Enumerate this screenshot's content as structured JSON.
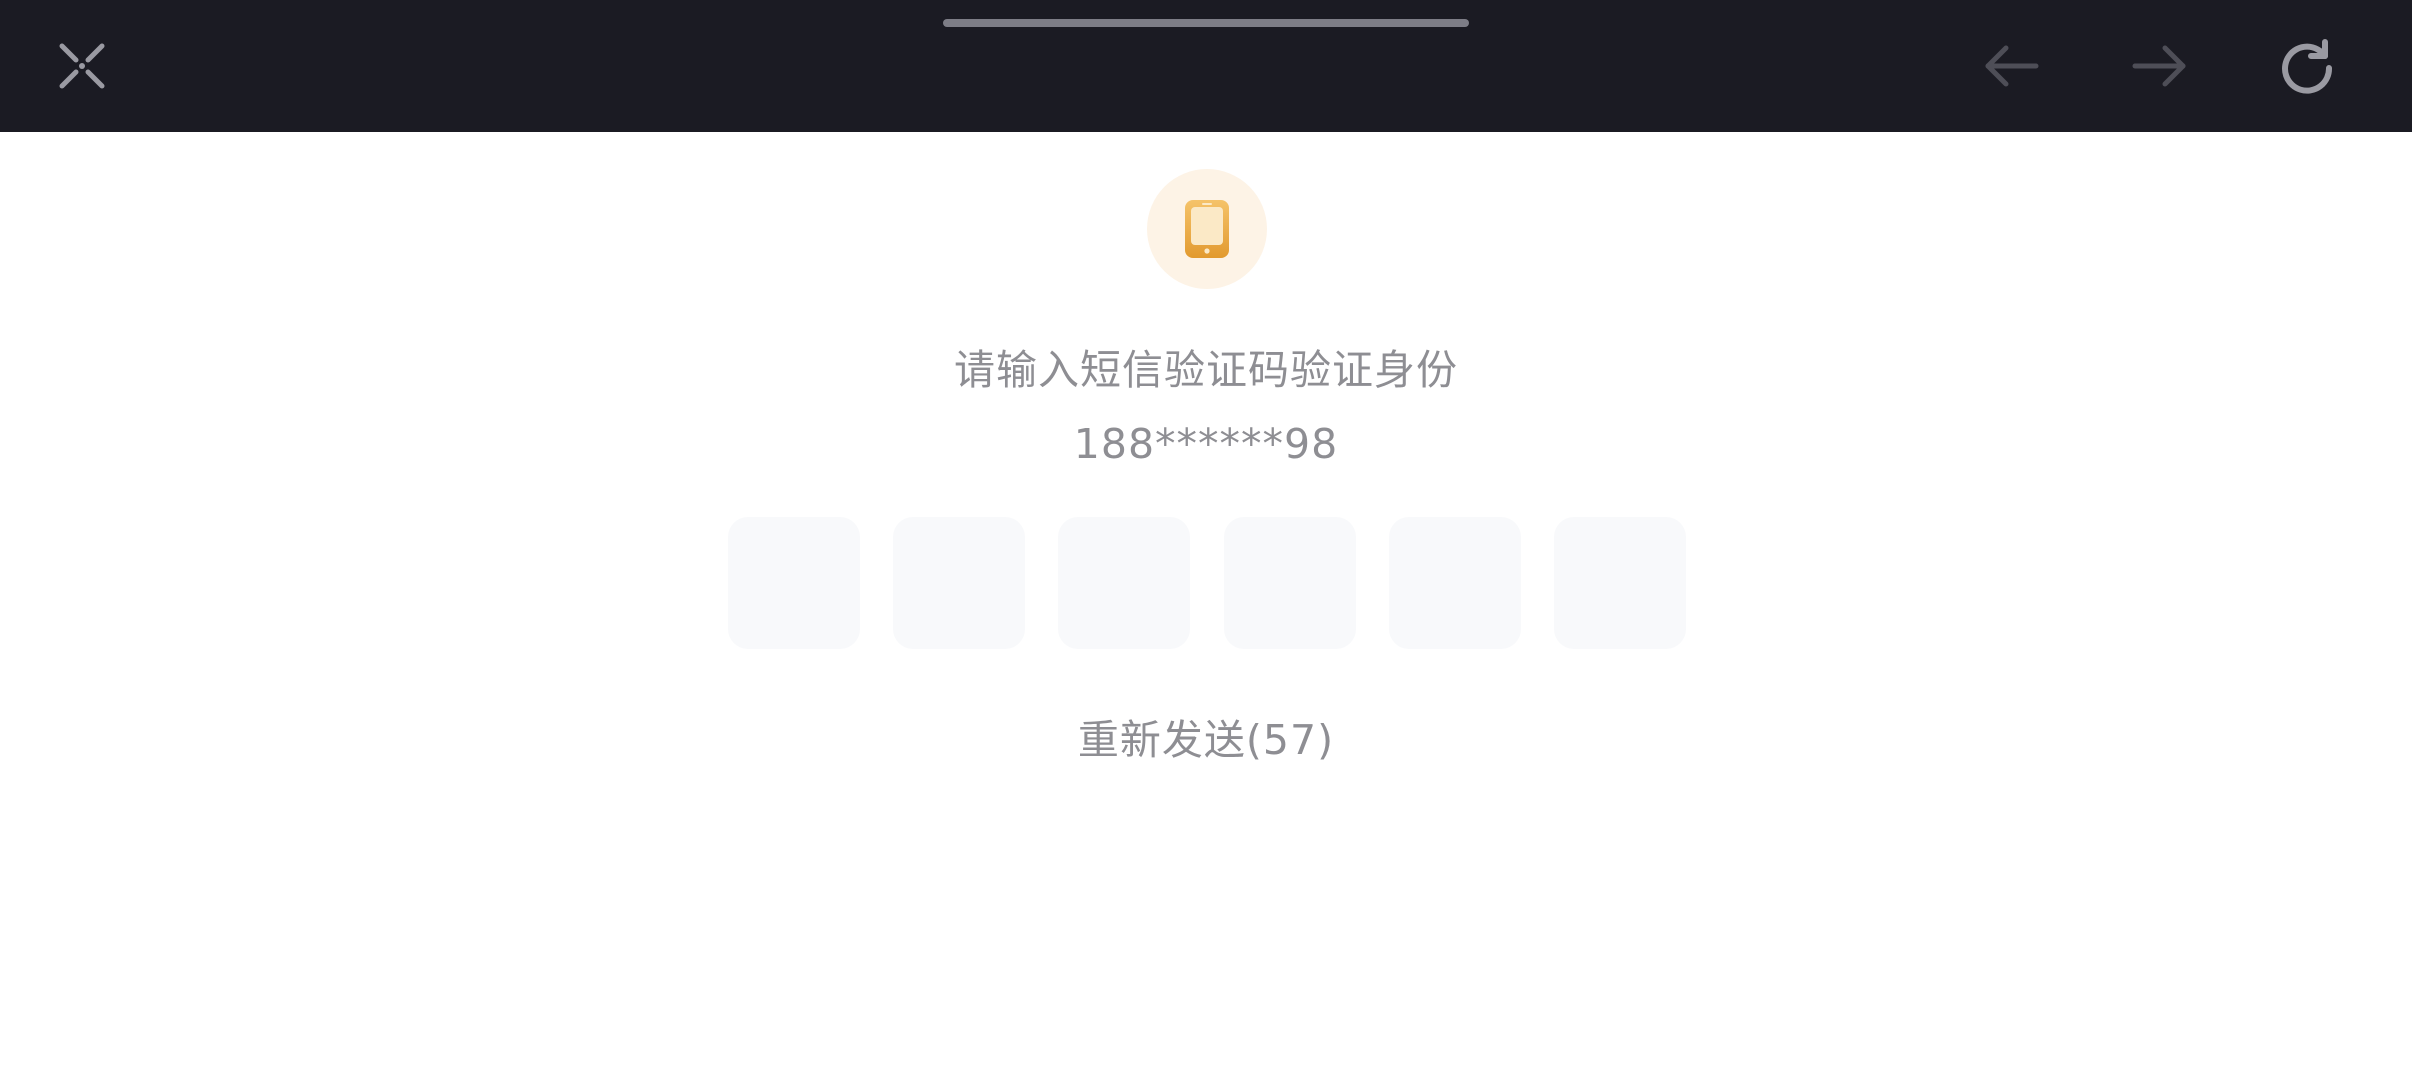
{
  "toolbar": {
    "close_icon": "close-x-icon",
    "back_icon": "arrow-left-icon",
    "forward_icon": "arrow-right-icon",
    "reload_icon": "reload-icon",
    "bg_color": "#1b1b23",
    "icon_color": "#8a8a92"
  },
  "verify": {
    "icon": "phone-icon",
    "icon_color": "#e9a23b",
    "badge_color": "#fdf3e6",
    "prompt": "请输入短信验证码验证身份",
    "phone_number": "188******98",
    "code_boxes": [
      "",
      "",
      "",
      "",
      "",
      ""
    ],
    "resend_label": "重新发送(57)"
  }
}
